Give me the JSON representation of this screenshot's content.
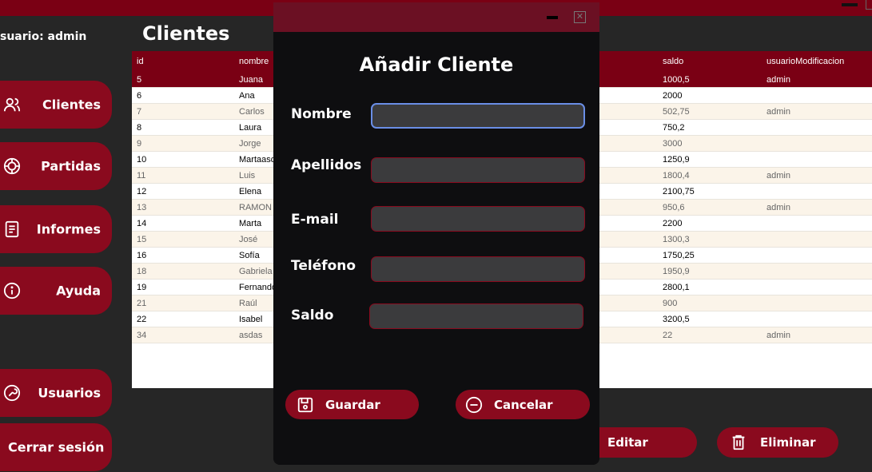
{
  "user_label": "suario: admin",
  "page_title": "Clientes",
  "sidebar": {
    "items": [
      {
        "label": "Clientes",
        "icon": "users-icon"
      },
      {
        "label": "Partidas",
        "icon": "poker-chip-icon"
      },
      {
        "label": "Informes",
        "icon": "document-icon"
      },
      {
        "label": "Ayuda",
        "icon": "info-icon"
      },
      {
        "label": "Usuarios",
        "icon": "wrench-icon"
      }
    ],
    "logout_label": "Cerrar sesión"
  },
  "table": {
    "columns": [
      "id",
      "nombre",
      "saldo",
      "usuarioModificacion"
    ],
    "rows": [
      {
        "id": "5",
        "nombre": "Juana",
        "saldo": "1000,5",
        "mod": "admin"
      },
      {
        "id": "6",
        "nombre": "Ana",
        "saldo": "2000",
        "mod": ""
      },
      {
        "id": "7",
        "nombre": "Carlos",
        "saldo": "502,75",
        "mod": "admin"
      },
      {
        "id": "8",
        "nombre": "Laura",
        "saldo": "750,2",
        "mod": ""
      },
      {
        "id": "9",
        "nombre": "Jorge",
        "saldo": "3000",
        "mod": ""
      },
      {
        "id": "10",
        "nombre": "Martaasd",
        "saldo": "1250,9",
        "mod": ""
      },
      {
        "id": "11",
        "nombre": "Luis",
        "saldo": "1800,4",
        "mod": "admin"
      },
      {
        "id": "12",
        "nombre": "Elena",
        "saldo": "2100,75",
        "mod": ""
      },
      {
        "id": "13",
        "nombre": "RAMON",
        "saldo": "950,6",
        "mod": "admin"
      },
      {
        "id": "14",
        "nombre": "Marta",
        "saldo": "2200",
        "mod": ""
      },
      {
        "id": "15",
        "nombre": "José",
        "saldo": "1300,3",
        "mod": ""
      },
      {
        "id": "16",
        "nombre": "Sofía",
        "saldo": "1750,25",
        "mod": ""
      },
      {
        "id": "18",
        "nombre": "Gabriela",
        "saldo": "1950,9",
        "mod": ""
      },
      {
        "id": "19",
        "nombre": "Fernando",
        "saldo": "2800,1",
        "mod": ""
      },
      {
        "id": "21",
        "nombre": "Raúl",
        "saldo": "900",
        "mod": ""
      },
      {
        "id": "22",
        "nombre": "Isabel",
        "saldo": "3200,5",
        "mod": ""
      },
      {
        "id": "34",
        "nombre": "asdas",
        "saldo": "22",
        "mod": "admin"
      }
    ]
  },
  "bottom_buttons": {
    "edit_label": "Editar",
    "delete_label": "Eliminar"
  },
  "modal": {
    "title": "Añadir Cliente",
    "close_glyph": "✕",
    "fields": [
      {
        "label": "Nombre",
        "value": ""
      },
      {
        "label": "Apellidos",
        "value": ""
      },
      {
        "label": "E-mail",
        "value": ""
      },
      {
        "label": "Teléfono",
        "value": ""
      },
      {
        "label": "Saldo",
        "value": ""
      }
    ],
    "save_label": "Guardar",
    "cancel_label": "Cancelar"
  },
  "colors": {
    "accent": "#8a0a1e",
    "header": "#7a0014",
    "background": "#262626",
    "modal_bg": "#0e0e10",
    "focus": "#6a8ee6"
  }
}
